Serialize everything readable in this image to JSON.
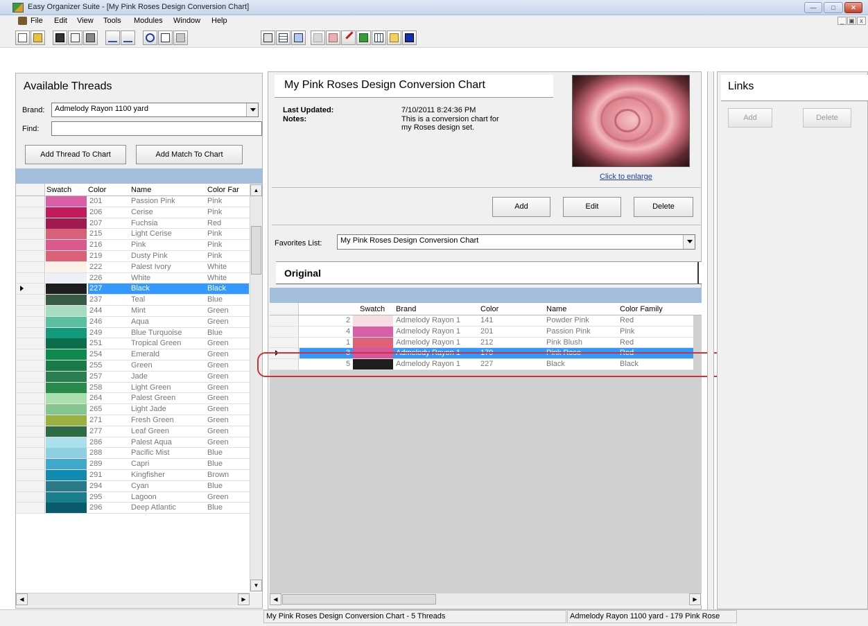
{
  "window": {
    "title": "Easy Organizer Suite - [My Pink Roses Design Conversion Chart]"
  },
  "menu": {
    "items": [
      "File",
      "Edit",
      "View",
      "Tools",
      "Modules",
      "Window",
      "Help"
    ]
  },
  "left_panel": {
    "title": "Available Threads",
    "brand_label": "Brand:",
    "brand_value": "Admelody Rayon 1100 yard",
    "find_label": "Find:",
    "find_value": "",
    "add_thread_button": "Add Thread To Chart",
    "add_match_button": "Add Match To Chart",
    "columns": [
      "Swatch",
      "Color",
      "Name",
      "Color Far"
    ],
    "rows": [
      {
        "color": "201",
        "name": "Passion Pink",
        "family": "Pink",
        "swatch": "#d95fa8"
      },
      {
        "color": "206",
        "name": "Cerise",
        "family": "Pink",
        "swatch": "#c41a5e"
      },
      {
        "color": "207",
        "name": "Fuchsia",
        "family": "Red",
        "swatch": "#a01b50"
      },
      {
        "color": "215",
        "name": "Light Cerise",
        "family": "Pink",
        "swatch": "#d9607a"
      },
      {
        "color": "216",
        "name": "Pink",
        "family": "Pink",
        "swatch": "#d95a8a"
      },
      {
        "color": "219",
        "name": "Dusty Pink",
        "family": "Pink",
        "swatch": "#d96278"
      },
      {
        "color": "222",
        "name": "Palest Ivory",
        "family": "White",
        "swatch": "#f8f2e8"
      },
      {
        "color": "226",
        "name": "White",
        "family": "White",
        "swatch": "#eef0f8"
      },
      {
        "color": "227",
        "name": "Black",
        "family": "Black",
        "swatch": "#1e1e1e",
        "selected": true
      },
      {
        "color": "237",
        "name": "Teal",
        "family": "Blue",
        "swatch": "#3a5a48"
      },
      {
        "color": "244",
        "name": "Mint",
        "family": "Green",
        "swatch": "#a8dcc0"
      },
      {
        "color": "246",
        "name": "Aqua",
        "family": "Green",
        "swatch": "#5ac0a0"
      },
      {
        "color": "249",
        "name": "Blue Turquoise",
        "family": "Blue",
        "swatch": "#139a7c"
      },
      {
        "color": "251",
        "name": "Tropical Green",
        "family": "Green",
        "swatch": "#0a6e4a"
      },
      {
        "color": "254",
        "name": "Emerald",
        "family": "Green",
        "swatch": "#0e8a4c"
      },
      {
        "color": "255",
        "name": "Green",
        "family": "Green",
        "swatch": "#1a7a4a"
      },
      {
        "color": "257",
        "name": "Jade",
        "family": "Green",
        "swatch": "#2a7e50"
      },
      {
        "color": "258",
        "name": "Light Green",
        "family": "Green",
        "swatch": "#2a8a4a"
      },
      {
        "color": "264",
        "name": "Palest Green",
        "family": "Green",
        "swatch": "#a8e0b0"
      },
      {
        "color": "265",
        "name": "Light Jade",
        "family": "Green",
        "swatch": "#86c490"
      },
      {
        "color": "271",
        "name": "Fresh Green",
        "family": "Green",
        "swatch": "#9ab040"
      },
      {
        "color": "277",
        "name": "Leaf Green",
        "family": "Green",
        "swatch": "#2e6a44"
      },
      {
        "color": "286",
        "name": "Palest Aqua",
        "family": "Green",
        "swatch": "#a8e0ec"
      },
      {
        "color": "288",
        "name": "Pacific Mist",
        "family": "Blue",
        "swatch": "#8ed0e0"
      },
      {
        "color": "289",
        "name": "Capri",
        "family": "Blue",
        "swatch": "#40a8c8"
      },
      {
        "color": "291",
        "name": "Kingfisher",
        "family": "Brown",
        "swatch": "#108ab0"
      },
      {
        "color": "294",
        "name": "Cyan",
        "family": "Blue",
        "swatch": "#2a7a8a"
      },
      {
        "color": "295",
        "name": "Lagoon",
        "family": "Green",
        "swatch": "#1a7e8e"
      },
      {
        "color": "296",
        "name": "Deep Atlantic",
        "family": "Blue",
        "swatch": "#0a5a6e"
      }
    ]
  },
  "chart": {
    "title": "My Pink Roses Design Conversion Chart",
    "last_updated_label": "Last Updated:",
    "last_updated_value": "7/10/2011 8:24:36 PM",
    "notes_label": "Notes:",
    "notes_line1": "This is a conversion chart for",
    "notes_line2": "my Roses design set.",
    "enlarge_link": "Click to enlarge",
    "add_button": "Add",
    "edit_button": "Edit",
    "delete_button": "Delete",
    "favorites_label": "Favorites List:",
    "favorites_value": "My Pink Roses Design Conversion Chart",
    "section_title": "Original",
    "columns": [
      "Swatch",
      "Brand",
      "Color",
      "Name",
      "Color Family"
    ],
    "rows": [
      {
        "num": "2",
        "brand": "Admelody Rayon 1",
        "color": "141",
        "name": "Powder Pink",
        "family": "Red",
        "swatch": "#f6dde2"
      },
      {
        "num": "4",
        "brand": "Admelody Rayon 1",
        "color": "201",
        "name": "Passion Pink",
        "family": "Pink",
        "swatch": "#d95fa8"
      },
      {
        "num": "1",
        "brand": "Admelody Rayon 1",
        "color": "212",
        "name": "Pink Blush",
        "family": "Red",
        "swatch": "#e0607a"
      },
      {
        "num": "3",
        "brand": "Admelody Rayon 1",
        "color": "179",
        "name": "Pink Rose",
        "family": "Red",
        "swatch": "#d7559a",
        "selected": true
      },
      {
        "num": "5",
        "brand": "Admelody Rayon 1",
        "color": "227",
        "name": "Black",
        "family": "Black",
        "swatch": "#1e1e1e"
      }
    ]
  },
  "links": {
    "title": "Links",
    "add_button": "Add",
    "delete_button": "Delete"
  },
  "status": {
    "left": "My Pink Roses Design Conversion Chart - 5 Threads",
    "right": "Admelody Rayon 1100 yard - 179 Pink Rose"
  },
  "colors": {
    "selection": "#3399ff",
    "grid_band": "#a4bfdd",
    "highlight_oval": "#cc3333"
  }
}
